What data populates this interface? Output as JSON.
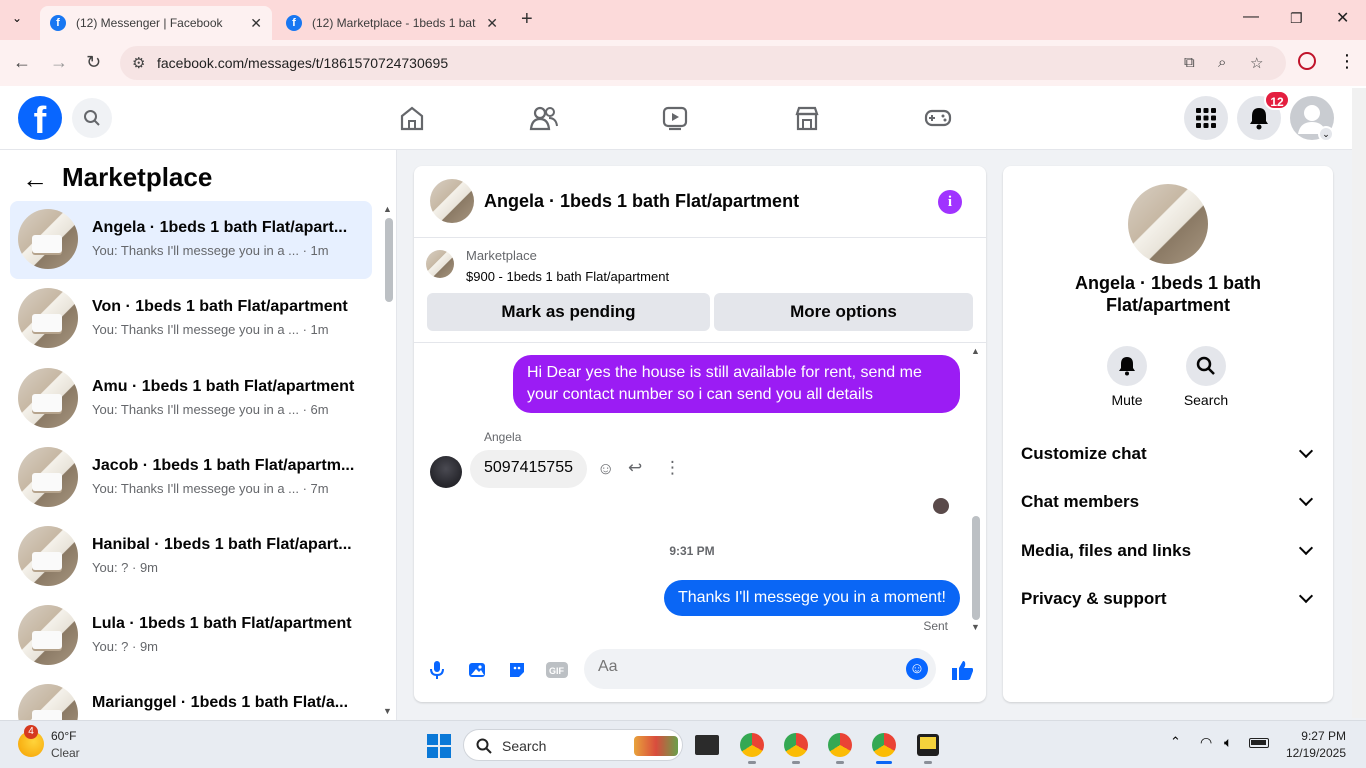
{
  "browser": {
    "tabs": [
      {
        "title": "(12) Messenger | Facebook",
        "active": true
      },
      {
        "title": "(12) Marketplace - 1beds 1 bat",
        "active": false
      }
    ],
    "url": "facebook.com/messages/t/1861570724730695"
  },
  "fb_header": {
    "notification_count": "12",
    "icons": [
      "home-icon",
      "friends-icon",
      "video-icon",
      "marketplace-icon",
      "gaming-icon",
      "menu-grid-icon",
      "bell-icon"
    ]
  },
  "left": {
    "title": "Marketplace",
    "chats": [
      {
        "name": "Angela · 1beds 1 bath Flat/apart...",
        "preview": "You: Thanks I'll messege you in a ... · 1m",
        "selected": true
      },
      {
        "name": "Von · 1beds 1 bath Flat/apartment",
        "preview": "You: Thanks I'll messege you in a ... · 1m",
        "selected": false
      },
      {
        "name": "Amu · 1beds 1 bath Flat/apartment",
        "preview": "You: Thanks I'll messege you in a ... · 6m",
        "selected": false
      },
      {
        "name": "Jacob · 1beds 1 bath Flat/apartm...",
        "preview": "You: Thanks I'll messege you in a ... · 7m",
        "selected": false
      },
      {
        "name": "Hanibal · 1beds 1 bath Flat/apart...",
        "preview": "You: ? · 9m",
        "selected": false
      },
      {
        "name": "Lula · 1beds 1 bath Flat/apartment",
        "preview": "You: ? · 9m",
        "selected": false
      },
      {
        "name": "Marianggel · 1beds 1 bath Flat/a...",
        "preview": "",
        "selected": false
      }
    ]
  },
  "chat": {
    "title": "Angela · 1beds 1 bath Flat/apartment",
    "marketplace_label": "Marketplace",
    "listing": "$900 - 1beds 1 bath Flat/apartment",
    "mark_pending": "Mark as pending",
    "more_options": "More options",
    "messages": {
      "out1": "Hi Dear yes the house is still available for rent, send me your contact number so i can send you all details",
      "sender": "Angela",
      "in1": "5097415755",
      "timestamp": "9:31 PM",
      "out2": "Thanks I'll messege you in a moment!",
      "status": "Sent"
    },
    "composer_placeholder": "Aa",
    "colors": {
      "purple_bubble": "#9b1cf4",
      "blue_bubble": "#0a66f5"
    }
  },
  "right": {
    "name": "Angela · 1beds 1 bath Flat/apartment",
    "mute": "Mute",
    "search": "Search",
    "sections": [
      "Customize chat",
      "Chat members",
      "Media, files and links",
      "Privacy & support"
    ]
  },
  "taskbar": {
    "weather_temp": "60°F",
    "weather_desc": "Clear",
    "weather_badge": "4",
    "search": "Search",
    "time": "9:27 PM",
    "date": "12/19/2025"
  }
}
